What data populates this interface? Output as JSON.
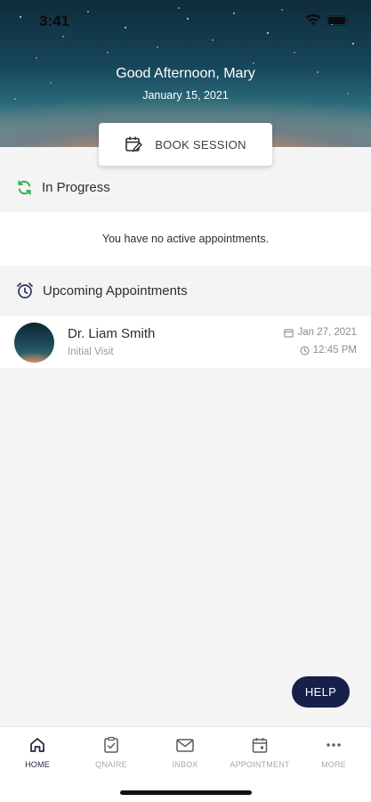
{
  "status_bar": {
    "time": "3:41"
  },
  "header": {
    "greeting": "Good Afternoon, Mary",
    "date": "January 15, 2021",
    "book_button_label": "BOOK SESSION"
  },
  "in_progress": {
    "title": "In Progress",
    "empty_message": "You have no active appointments."
  },
  "upcoming": {
    "title": "Upcoming Appointments",
    "items": [
      {
        "doctor": "Dr. Liam Smith",
        "type": "Initial Visit",
        "date": "Jan 27, 2021",
        "time": "12:45 PM"
      }
    ]
  },
  "help_button": {
    "label": "HELP"
  },
  "tabs": [
    {
      "label": "HOME",
      "icon": "home-icon",
      "active": true
    },
    {
      "label": "QNAIRE",
      "icon": "clipboard-check-icon",
      "active": false
    },
    {
      "label": "INBOX",
      "icon": "mail-icon",
      "active": false
    },
    {
      "label": "APPOINTMENT",
      "icon": "calendar-icon",
      "active": false
    },
    {
      "label": "MORE",
      "icon": "more-dots-icon",
      "active": false
    }
  ],
  "colors": {
    "accent_green": "#2bb24c",
    "help_button_bg": "#16204a",
    "active_tab": "#1d2240",
    "inactive_tab": "#a5a7ac"
  }
}
